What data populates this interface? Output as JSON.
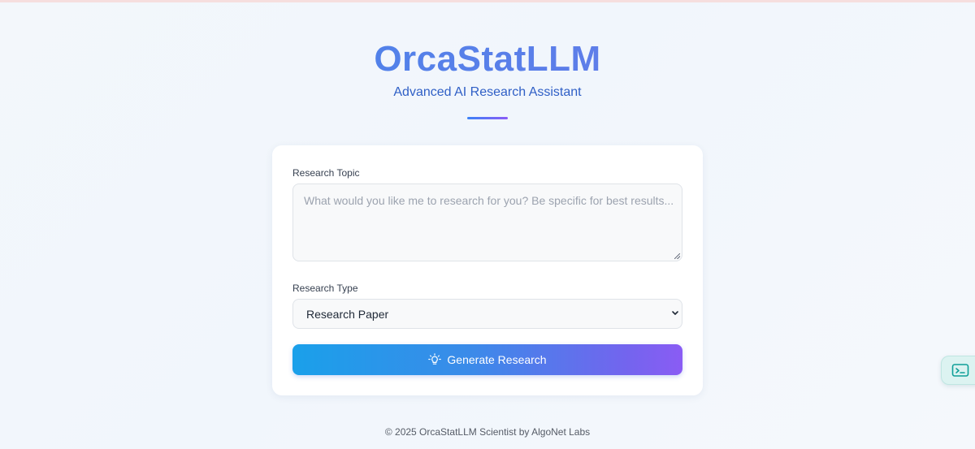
{
  "header": {
    "title": "OrcaStatLLM",
    "subtitle": "Advanced AI Research Assistant"
  },
  "form": {
    "topic_label": "Research Topic",
    "topic_placeholder": "What would you like me to research for you? Be specific for best results...",
    "topic_value": "",
    "type_label": "Research Type",
    "type_selected": "Research Paper",
    "generate_label": "Generate Research",
    "generate_icon": "lightbulb-icon"
  },
  "footer": {
    "text": "© 2025 OrcaStatLLM Scientist by AlgoNet Labs"
  },
  "side_widget": {
    "icon": "terminal-icon"
  },
  "colors": {
    "accent_blue": "#3b82f6",
    "accent_purple": "#8b5cf6",
    "button_start": "#1aa0ea",
    "button_end": "#8a5cf4",
    "widget_teal": "#0e9f98"
  }
}
